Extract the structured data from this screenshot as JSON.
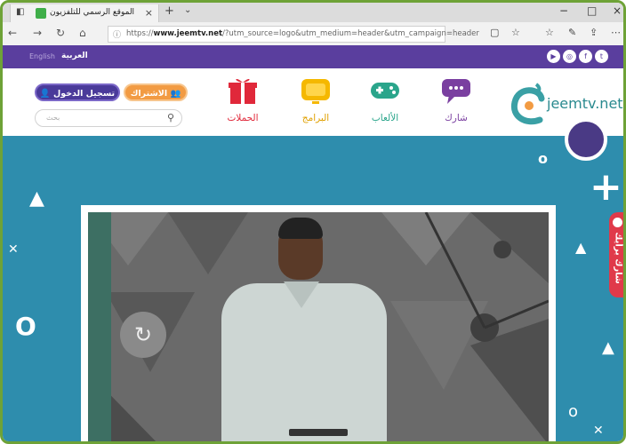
{
  "browser": {
    "tab_title": "الموقع الرسمي للتلفزيون",
    "tab_close": "×",
    "new_tab": "+",
    "url_prefix": "https://",
    "url_domain": "www.jeemtv.net",
    "url_rest": "/?utm_source=logo&utm_medium=header&utm_campaign=header",
    "win_min": "−",
    "win_max": "□",
    "win_close": "×"
  },
  "topbar": {
    "lang_arabic": "العربية",
    "lang_english": "English",
    "social_icons": [
      "twitter-icon",
      "facebook-icon",
      "instagram-icon",
      "youtube-icon"
    ]
  },
  "header": {
    "login_label": "تسجيل الدخول",
    "subscribe_label": "الاشتراك",
    "search_placeholder": "بحث",
    "logo_text": "jeemtv.net",
    "nav": [
      {
        "label": "الحملات",
        "icon": "gift-icon",
        "color": "#e0283a"
      },
      {
        "label": "البرامج",
        "icon": "tv-icon",
        "color": "#f5b800"
      },
      {
        "label": "الألعاب",
        "icon": "gamepad-icon",
        "color": "#2aa58b"
      },
      {
        "label": "شارك",
        "icon": "chat-icon",
        "color": "#7a3fa0"
      }
    ]
  },
  "sidebar_tab": {
    "label": "شارك برأيك"
  },
  "colors": {
    "brand_purple": "#5a3e9e",
    "page_bg": "#2e8dad",
    "accent_orange": "#f29b43",
    "share_red": "#e03a4a"
  }
}
